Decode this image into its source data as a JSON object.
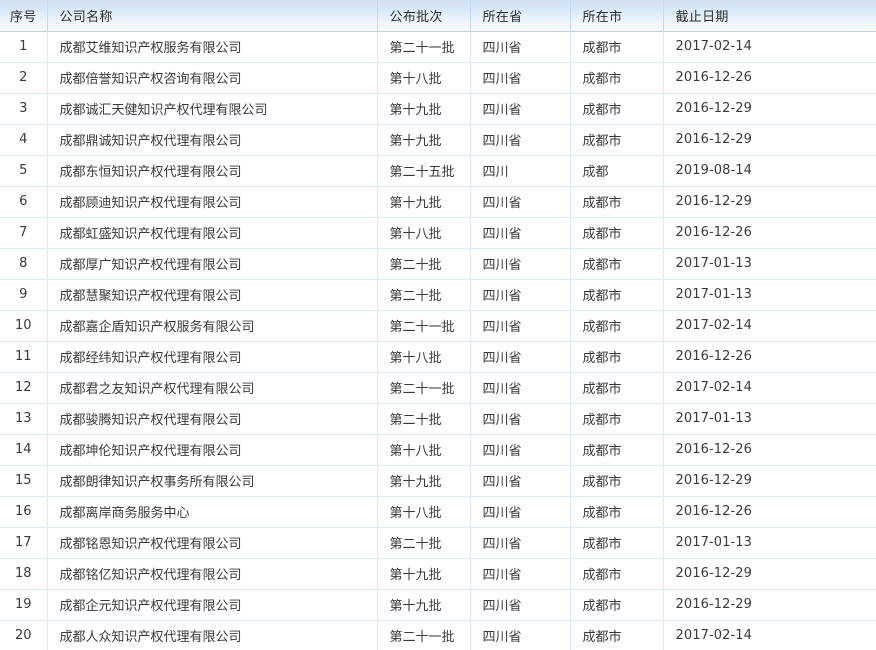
{
  "table": {
    "columns": [
      {
        "key": "seq",
        "label": "序号"
      },
      {
        "key": "company",
        "label": "公司名称"
      },
      {
        "key": "batch",
        "label": "公布批次"
      },
      {
        "key": "province",
        "label": "所在省"
      },
      {
        "key": "city",
        "label": "所在市"
      },
      {
        "key": "deadline",
        "label": "截止日期"
      }
    ],
    "rows": [
      {
        "seq": "1",
        "company": "成都艾维知识产权服务有限公司",
        "batch": "第二十一批",
        "province": "四川省",
        "city": "成都市",
        "deadline": "2017-02-14"
      },
      {
        "seq": "2",
        "company": "成都倍誉知识产权咨询有限公司",
        "batch": "第十八批",
        "province": "四川省",
        "city": "成都市",
        "deadline": "2016-12-26"
      },
      {
        "seq": "3",
        "company": "成都诚汇天健知识产权代理有限公司",
        "batch": "第十九批",
        "province": "四川省",
        "city": "成都市",
        "deadline": "2016-12-29"
      },
      {
        "seq": "4",
        "company": "成都鼎诚知识产权代理有限公司",
        "batch": "第十九批",
        "province": "四川省",
        "city": "成都市",
        "deadline": "2016-12-29"
      },
      {
        "seq": "5",
        "company": "成都东恒知识产权代理有限公司",
        "batch": "第二十五批",
        "province": "四川",
        "city": "成都",
        "deadline": "2019-08-14"
      },
      {
        "seq": "6",
        "company": "成都顾迪知识产权代理有限公司",
        "batch": "第十九批",
        "province": "四川省",
        "city": "成都市",
        "deadline": "2016-12-29"
      },
      {
        "seq": "7",
        "company": "成都虹盛知识产权代理有限公司",
        "batch": "第十八批",
        "province": "四川省",
        "city": "成都市",
        "deadline": "2016-12-26"
      },
      {
        "seq": "8",
        "company": "成都厚广知识产权代理有限公司",
        "batch": "第二十批",
        "province": "四川省",
        "city": "成都市",
        "deadline": "2017-01-13"
      },
      {
        "seq": "9",
        "company": "成都慧聚知识产权代理有限公司",
        "batch": "第二十批",
        "province": "四川省",
        "city": "成都市",
        "deadline": "2017-01-13"
      },
      {
        "seq": "10",
        "company": "成都嘉企盾知识产权服务有限公司",
        "batch": "第二十一批",
        "province": "四川省",
        "city": "成都市",
        "deadline": "2017-02-14"
      },
      {
        "seq": "11",
        "company": "成都经纬知识产权代理有限公司",
        "batch": "第十八批",
        "province": "四川省",
        "city": "成都市",
        "deadline": "2016-12-26"
      },
      {
        "seq": "12",
        "company": "成都君之友知识产权代理有限公司",
        "batch": "第二十一批",
        "province": "四川省",
        "city": "成都市",
        "deadline": "2017-02-14"
      },
      {
        "seq": "13",
        "company": "成都骏腾知识产权代理有限公司",
        "batch": "第二十批",
        "province": "四川省",
        "city": "成都市",
        "deadline": "2017-01-13"
      },
      {
        "seq": "14",
        "company": "成都坤伦知识产权代理有限公司",
        "batch": "第十八批",
        "province": "四川省",
        "city": "成都市",
        "deadline": "2016-12-26"
      },
      {
        "seq": "15",
        "company": "成都朗律知识产权事务所有限公司",
        "batch": "第十九批",
        "province": "四川省",
        "city": "成都市",
        "deadline": "2016-12-29"
      },
      {
        "seq": "16",
        "company": "成都离岸商务服务中心",
        "batch": "第十八批",
        "province": "四川省",
        "city": "成都市",
        "deadline": "2016-12-26"
      },
      {
        "seq": "17",
        "company": "成都铭恩知识产权代理有限公司",
        "batch": "第二十批",
        "province": "四川省",
        "city": "成都市",
        "deadline": "2017-01-13"
      },
      {
        "seq": "18",
        "company": "成都铭亿知识产权代理有限公司",
        "batch": "第十九批",
        "province": "四川省",
        "city": "成都市",
        "deadline": "2016-12-29"
      },
      {
        "seq": "19",
        "company": "成都企元知识产权代理有限公司",
        "batch": "第十九批",
        "province": "四川省",
        "city": "成都市",
        "deadline": "2016-12-29"
      },
      {
        "seq": "20",
        "company": "成都人众知识产权代理有限公司",
        "batch": "第二十一批",
        "province": "四川省",
        "city": "成都市",
        "deadline": "2017-02-14"
      }
    ]
  },
  "colors": {
    "header_top": "#cfe0f3",
    "header_bottom": "#f7fbfe",
    "grid_line": "#dce9f7",
    "header_border": "#b9d3ec",
    "text": "#3a3a3a"
  }
}
